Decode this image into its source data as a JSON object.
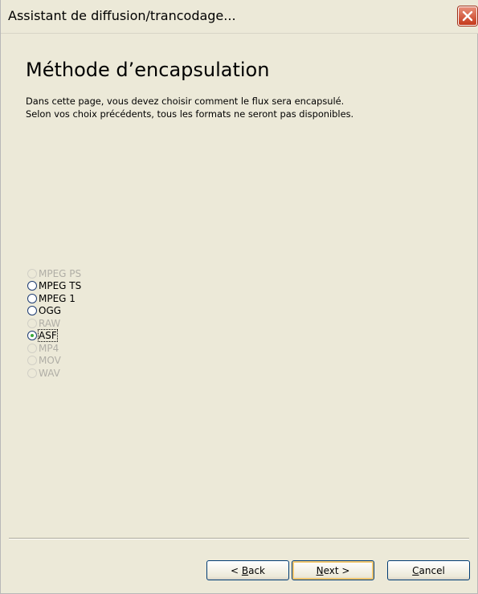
{
  "window": {
    "title": "Assistant de diffusion/trancodage..."
  },
  "page": {
    "heading": "Méthode d’encapsulation",
    "description": "Dans cette page, vous devez choisir comment le flux sera encapsulé. Selon vos choix précédents, tous les formats ne seront pas disponibles."
  },
  "formats": [
    {
      "label": "MPEG PS",
      "enabled": false,
      "selected": false
    },
    {
      "label": "MPEG TS",
      "enabled": true,
      "selected": false
    },
    {
      "label": "MPEG 1",
      "enabled": true,
      "selected": false
    },
    {
      "label": "OGG",
      "enabled": true,
      "selected": false
    },
    {
      "label": "RAW",
      "enabled": false,
      "selected": false
    },
    {
      "label": "ASF",
      "enabled": true,
      "selected": true
    },
    {
      "label": "MP4",
      "enabled": false,
      "selected": false
    },
    {
      "label": "MOV",
      "enabled": false,
      "selected": false
    },
    {
      "label": "WAV",
      "enabled": false,
      "selected": false
    }
  ],
  "buttons": {
    "back": {
      "prefix": "< ",
      "mnemonic": "B",
      "rest": "ack"
    },
    "next": {
      "mnemonic": "N",
      "rest": "ext >"
    },
    "cancel": {
      "mnemonic": "C",
      "rest": "ancel"
    }
  },
  "colors": {
    "window_bg": "#ece9d8",
    "close_button": "#c5391b",
    "selected_dot": "#3aa83a"
  }
}
